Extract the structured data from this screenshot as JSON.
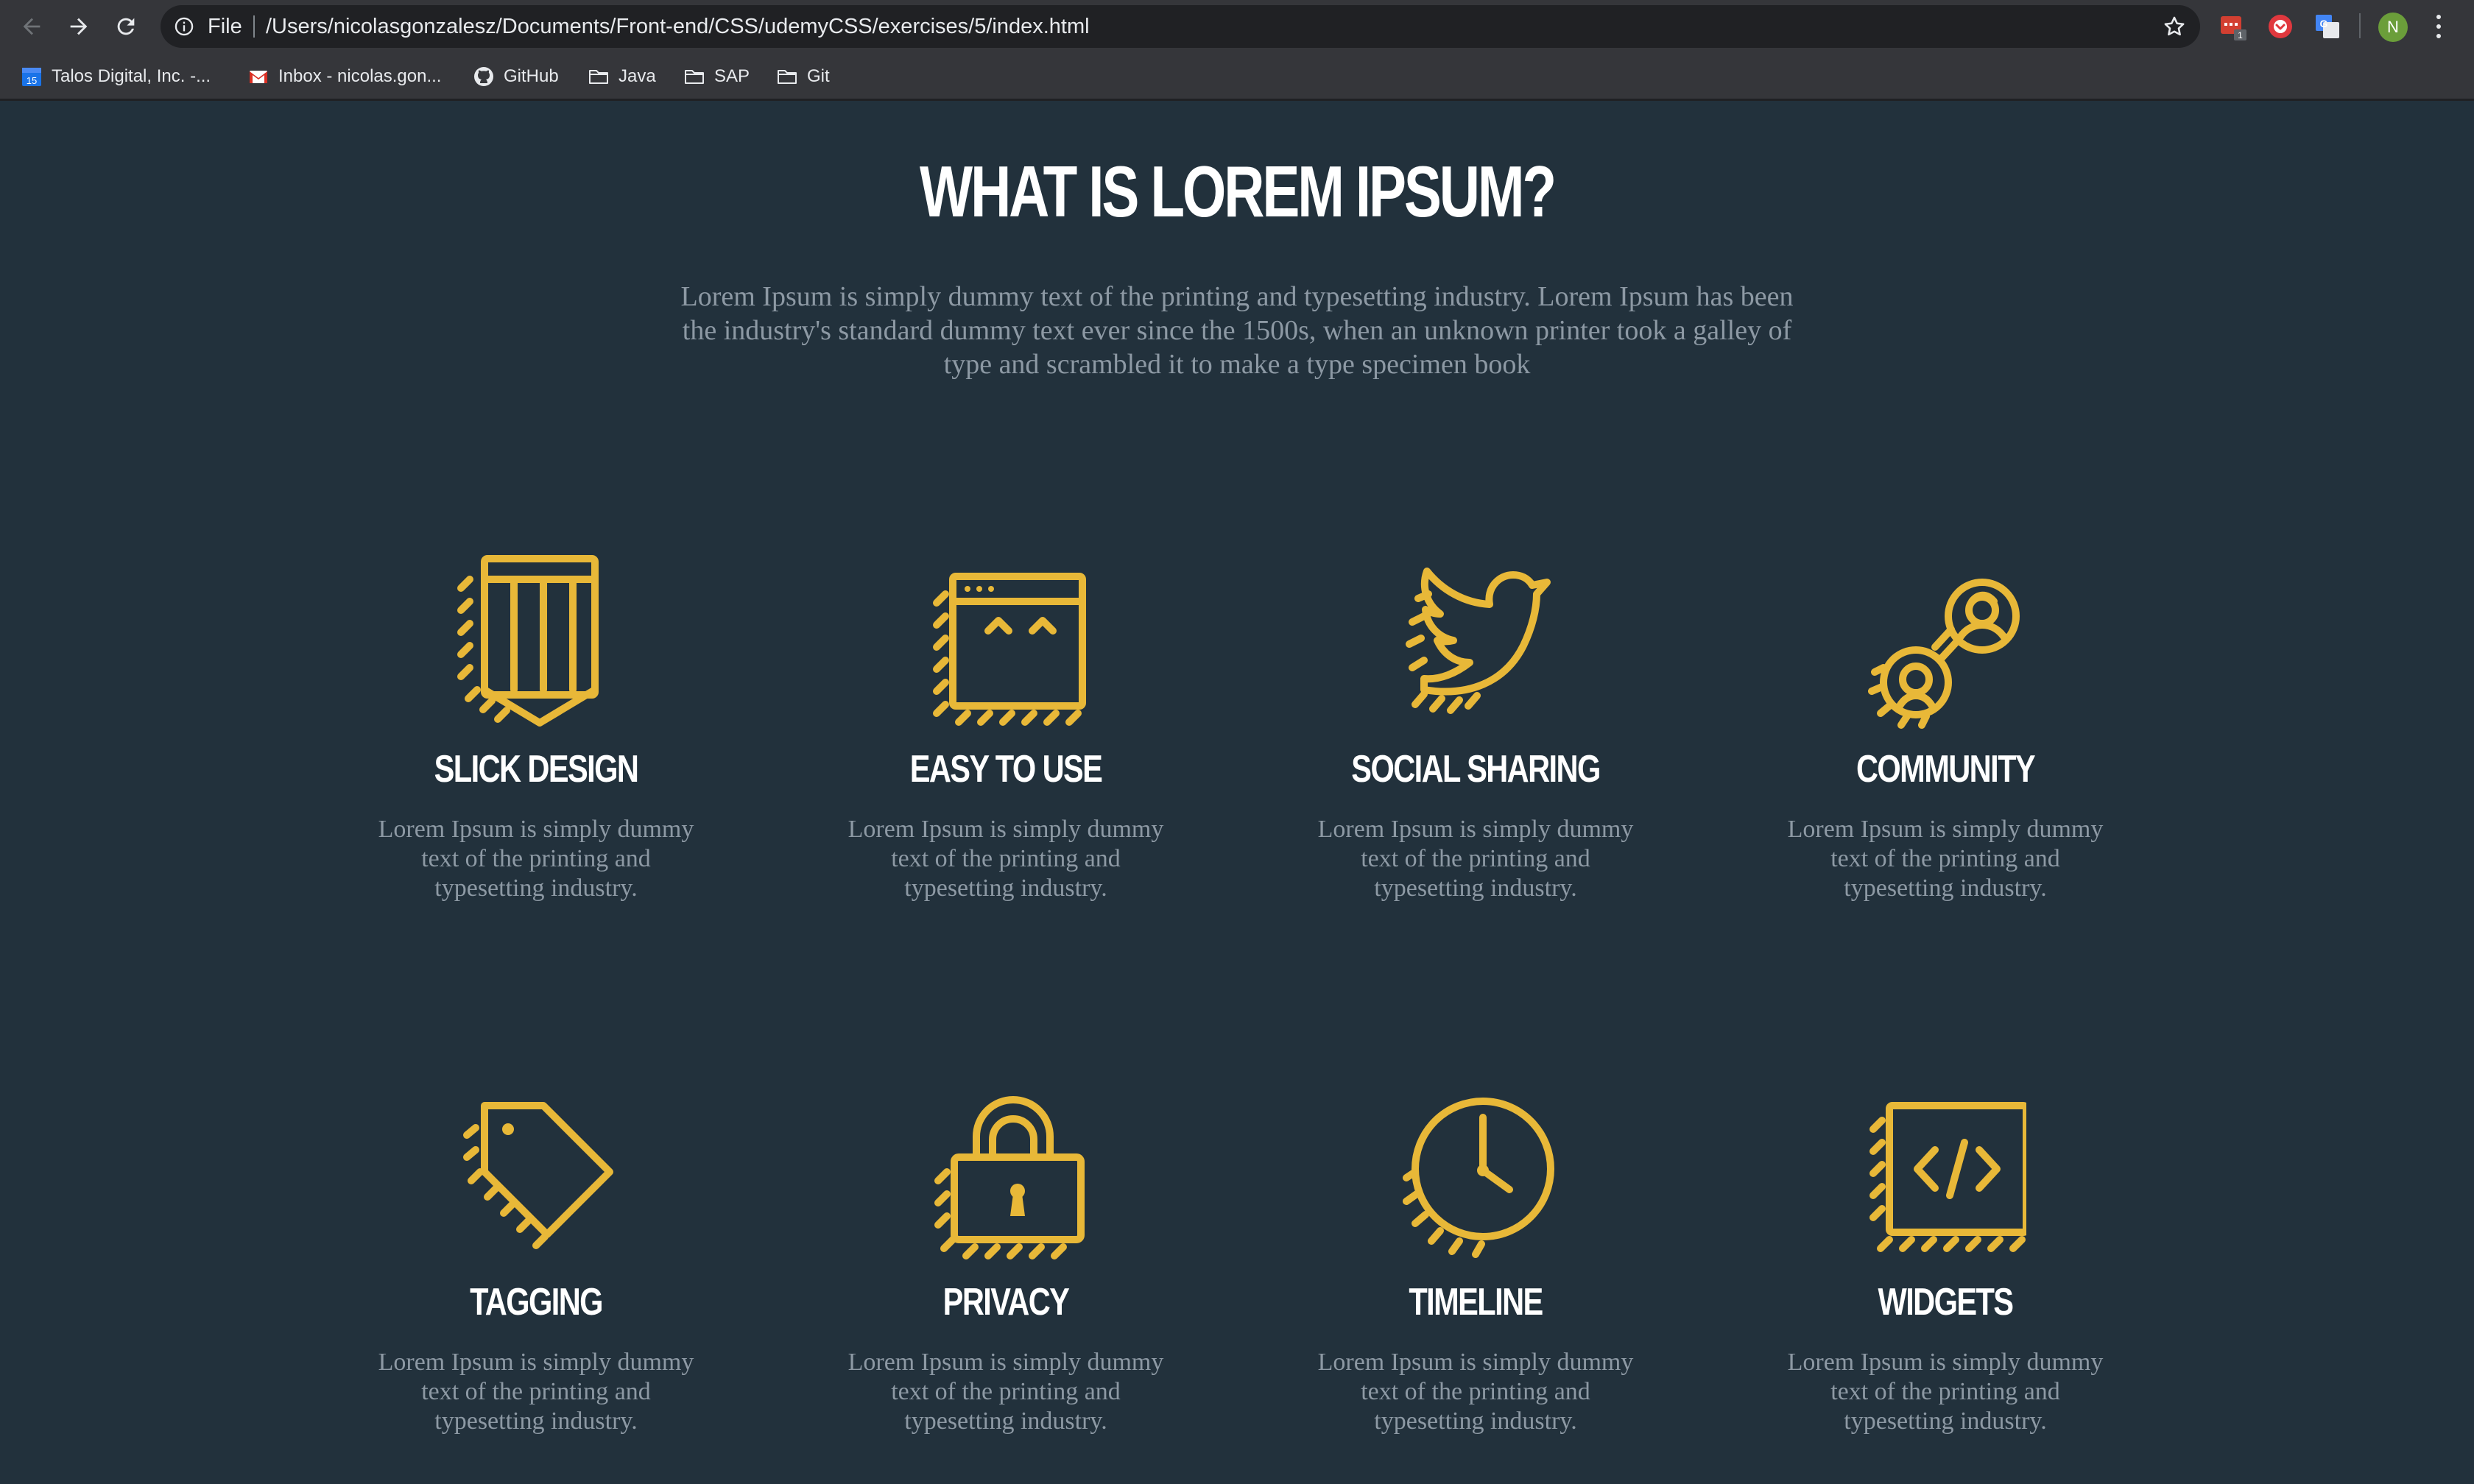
{
  "browser": {
    "scheme_label": "File",
    "url": "/Users/nicolasgonzalesz/Documents/Front-end/CSS/udemyCSS/exercises/5/index.html",
    "profile_initial": "N",
    "extension_badge": "1",
    "calendar_day": "15",
    "bookmarks": [
      {
        "label": "Talos Digital, Inc. -...",
        "icon": "calendar-icon"
      },
      {
        "label": "Inbox - nicolas.gon...",
        "icon": "gmail-icon"
      },
      {
        "label": "GitHub",
        "icon": "github-icon"
      },
      {
        "label": "Java",
        "icon": "folder-icon"
      },
      {
        "label": "SAP",
        "icon": "folder-icon"
      },
      {
        "label": "Git",
        "icon": "folder-icon"
      }
    ]
  },
  "page": {
    "title": "WHAT IS LOREM IPSUM?",
    "intro": "Lorem Ipsum is simply dummy text of the printing and typesetting industry. Lorem Ipsum has been the industry's standard dummy text ever since the 1500s, when an unknown printer took a galley of type and scrambled it to make a type specimen book",
    "accent_color": "#e8b838",
    "background_color": "#22313c",
    "features": [
      {
        "title": "SLICK DESIGN",
        "icon": "pencil-icon",
        "text": "Lorem Ipsum is simply dummy text of the printing and typesetting industry."
      },
      {
        "title": "EASY TO USE",
        "icon": "browser-window-icon",
        "text": "Lorem Ipsum is simply dummy text of the printing and typesetting industry."
      },
      {
        "title": "SOCIAL SHARING",
        "icon": "twitter-bird-icon",
        "text": "Lorem Ipsum is simply dummy text of the printing and typesetting industry."
      },
      {
        "title": "COMMUNITY",
        "icon": "community-people-icon",
        "text": "Lorem Ipsum is simply dummy text of the printing and typesetting industry."
      },
      {
        "title": "TAGGING",
        "icon": "tag-icon",
        "text": "Lorem Ipsum is simply dummy text of the printing and typesetting industry."
      },
      {
        "title": "PRIVACY",
        "icon": "padlock-icon",
        "text": "Lorem Ipsum is simply dummy text of the printing and typesetting industry."
      },
      {
        "title": "TIMELINE",
        "icon": "clock-icon",
        "text": "Lorem Ipsum is simply dummy text of the printing and typesetting industry."
      },
      {
        "title": "WIDGETS",
        "icon": "code-widget-icon",
        "text": "Lorem Ipsum is simply dummy text of the printing and typesetting industry."
      }
    ]
  }
}
